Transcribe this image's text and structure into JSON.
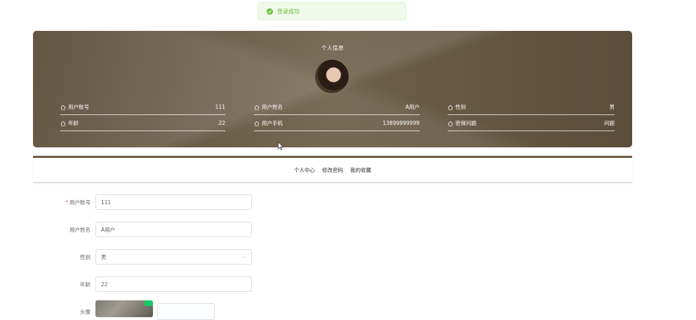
{
  "toast": {
    "message": "登录成功",
    "icon": "check-circle-icon",
    "color": "#67c23a"
  },
  "profile": {
    "title": "个人信息",
    "fields": [
      {
        "label": "用户账号",
        "value": "111"
      },
      {
        "label": "用户姓名",
        "value": "A用户"
      },
      {
        "label": "性别",
        "value": "男"
      },
      {
        "label": "年龄",
        "value": "22"
      },
      {
        "label": "用户手机",
        "value": "13899999999"
      },
      {
        "label": "密保问题",
        "value": "问题"
      }
    ]
  },
  "tabs": [
    "个人中心",
    "修改密码",
    "我的收藏"
  ],
  "form": {
    "account": {
      "label": "用户账号",
      "value": "111",
      "required": true
    },
    "name": {
      "label": "用户姓名",
      "value": "A用户"
    },
    "gender": {
      "label": "性别",
      "value": "男"
    },
    "age": {
      "label": "年龄",
      "value": "22"
    },
    "avatar": {
      "label": "头像"
    }
  },
  "colors": {
    "panel": "#6e604a",
    "accent_bar": "#6e5e45"
  }
}
